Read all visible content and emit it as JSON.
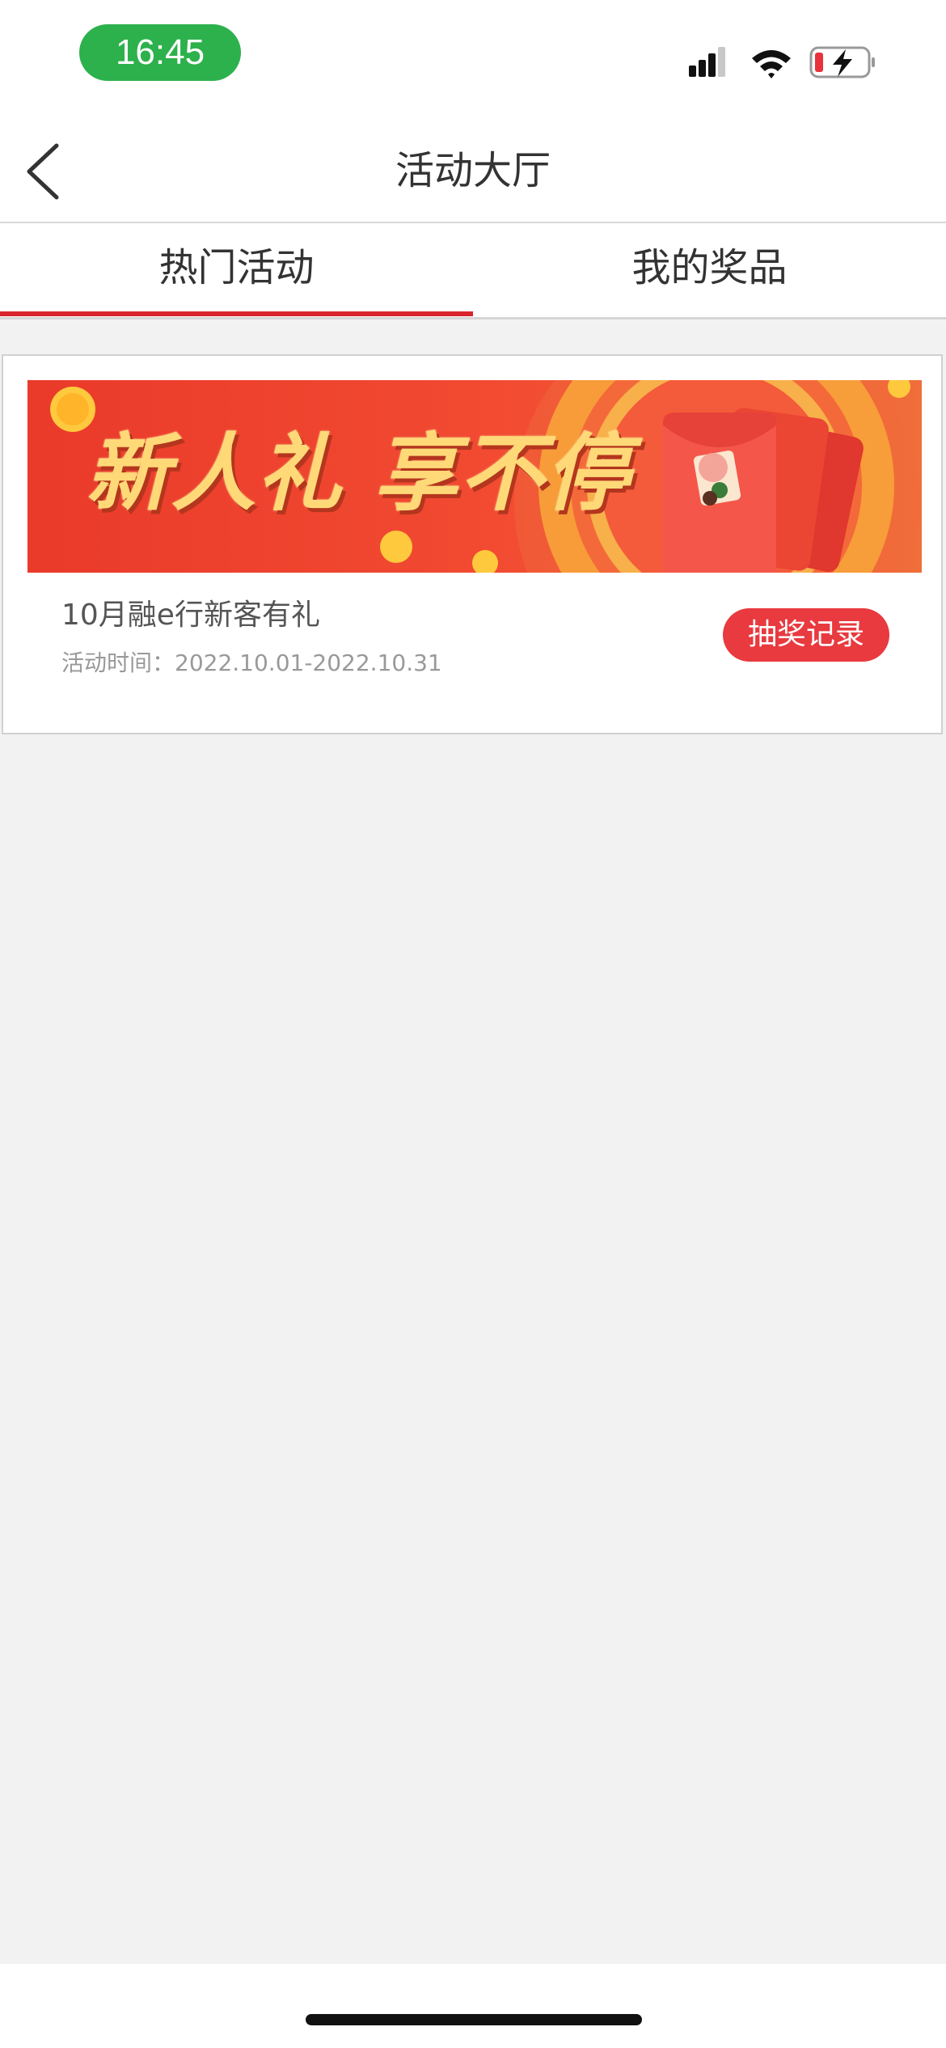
{
  "status_bar": {
    "time": "16:45",
    "time_pill_color": "#2db14c",
    "icons": [
      "cellular-signal-icon",
      "wifi-icon",
      "battery-charging-icon"
    ]
  },
  "nav": {
    "back_icon": "chevron-left-icon",
    "title": "活动大厅"
  },
  "tabs": [
    {
      "label": "热门活动",
      "active": true
    },
    {
      "label": "我的奖品",
      "active": false
    }
  ],
  "colors": {
    "accent": "#d9252f",
    "button": "#e83a3f"
  },
  "activity": {
    "banner_text": "新人礼 享不停",
    "title": "10月融e行新客有礼",
    "time": "活动时间：2022.10.01-2022.10.31",
    "record_button": "抽奖记录"
  }
}
